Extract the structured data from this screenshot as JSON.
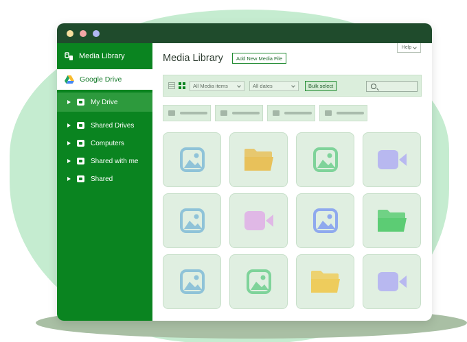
{
  "window": {
    "dots": [
      "#f7df9e",
      "#f4a6a6",
      "#b0b8f2"
    ]
  },
  "sidebar": {
    "header": {
      "label": "Media Library",
      "icon": "media-library-icon"
    },
    "source": {
      "label": "Google Drive",
      "icon": "google-drive-icon"
    },
    "items": [
      {
        "label": "My Drive",
        "icon": "my-drive-icon",
        "active": true
      },
      {
        "label": "Shared Drives",
        "icon": "shared-drives-icon"
      },
      {
        "label": "Computers",
        "icon": "computers-icon"
      },
      {
        "label": "Shared with me",
        "icon": "shared-with-me-icon"
      },
      {
        "label": "Shared",
        "icon": "shared-icon"
      }
    ]
  },
  "main": {
    "title": "Media Library",
    "add_button": "Add New Media File",
    "help": "Help"
  },
  "toolbar": {
    "filter_type": "All Media items",
    "filter_date": "All dates",
    "bulk_select": "Bulk select",
    "search_value": ""
  },
  "folder_chips_count": 4,
  "tiles": [
    {
      "icon": "image-icon",
      "color": "#8fc3d8"
    },
    {
      "icon": "folder-icon",
      "color": "#e8c15a"
    },
    {
      "icon": "image-icon",
      "color": "#7fd39a"
    },
    {
      "icon": "video-icon",
      "color": "#b8b8f0"
    },
    {
      "icon": "image-icon",
      "color": "#8fc3d8"
    },
    {
      "icon": "video-icon",
      "color": "#e0b8e6"
    },
    {
      "icon": "image-icon",
      "color": "#8fa9ee"
    },
    {
      "icon": "folder-icon",
      "color": "#5ccc74"
    },
    {
      "icon": "image-icon",
      "color": "#8fc3d8"
    },
    {
      "icon": "image-icon",
      "color": "#7fd39a"
    },
    {
      "icon": "folder-icon",
      "color": "#eecc5c"
    },
    {
      "icon": "video-icon",
      "color": "#b8b8f0"
    }
  ],
  "colors": {
    "sidebar": "#0a8420",
    "titlebar": "#1f4b2c",
    "accent": "#1f8a30"
  }
}
